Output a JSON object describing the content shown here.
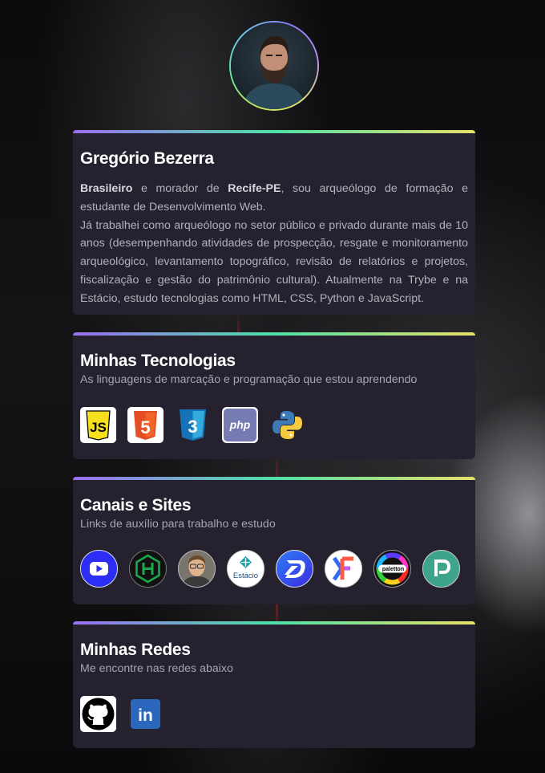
{
  "profile": {
    "name": "Gregório Bezerra",
    "bio": {
      "p1": [
        {
          "text": "Brasileiro",
          "bold": true
        },
        {
          "text": " e morador de ",
          "bold": false
        },
        {
          "text": "Recife-PE",
          "bold": true
        },
        {
          "text": ", sou arqueólogo de formação e estudante de Desenvolvimento Web.",
          "bold": false
        }
      ],
      "p2": "Já trabalhei como arqueólogo no setor público e privado durante mais de 10 anos (desempenhando atividades de prospecção, resgate e monitoramento arqueológico, levantamento topográfico, revisão de relatórios e projetos, fiscalização e gestão do patrimônio cultural). Atualmente na Trybe e na Estácio, estudo tecnologias como HTML, CSS, Python e JavaScript."
    }
  },
  "technologies": {
    "title": "Minhas Tecnologias",
    "subtitle": "As linguagens de marcação e programação que estou aprendendo",
    "items": [
      {
        "name": "javascript-icon",
        "label": "JS",
        "color": "#f7df1e"
      },
      {
        "name": "html5-icon",
        "label": "5",
        "color": "#e44d26"
      },
      {
        "name": "css3-icon",
        "label": "3",
        "color": "#2596d8"
      },
      {
        "name": "php-icon",
        "label": "php",
        "color": "#777bb3"
      },
      {
        "name": "python-icon",
        "label": "",
        "color": "#3572a5"
      }
    ]
  },
  "channels": {
    "title": "Canais e Sites",
    "subtitle": "Links de auxílio para trabalho e estudo",
    "items": [
      {
        "name": "youtube-channel-icon",
        "label": "",
        "color": "#2d2ef5"
      },
      {
        "name": "hackerrank-icon",
        "label": "",
        "color": "#1ba94c"
      },
      {
        "name": "person-channel-avatar-icon",
        "label": "",
        "color": "#8f8a80"
      },
      {
        "name": "estacio-icon",
        "label": "Estácio",
        "color": "#ffffff"
      },
      {
        "name": "dio-icon",
        "label": "",
        "color": "#3047f2"
      },
      {
        "name": "kaggle-f-icon",
        "label": "",
        "color": "#ffffff"
      },
      {
        "name": "paletton-icon",
        "label": "paletton",
        "color": "#111111"
      },
      {
        "name": "pexels-p-icon",
        "label": "",
        "color": "#3ea58a"
      }
    ]
  },
  "networks": {
    "title": "Minhas Redes",
    "subtitle": "Me encontre nas redes abaixo",
    "items": [
      {
        "name": "github-icon",
        "label": "",
        "color": "#000000"
      },
      {
        "name": "linkedin-icon",
        "label": "in",
        "color": "#0a66c2"
      }
    ]
  }
}
